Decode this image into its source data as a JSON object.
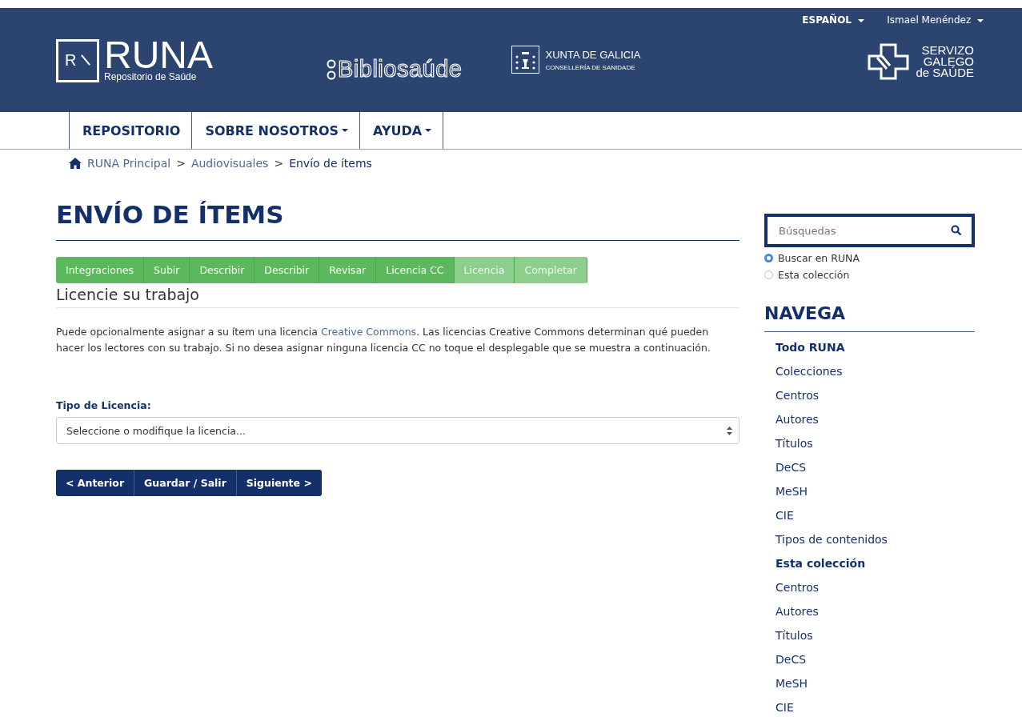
{
  "header": {
    "language": "ESPAÑOL",
    "user": "Ismael Menéndez",
    "logo_title": "RUNA",
    "logo_subtitle": "Repositorio de Saúde",
    "logo_mark": "R",
    "partner": "Bibliosaúde",
    "xunta_title": "XUNTA DE GALICIA",
    "xunta_subtitle": "CONSELLERÍA DE SANIDADE",
    "sergas_lines": [
      "SERVIZO",
      "GALEGO",
      "de SAÚDE"
    ]
  },
  "nav": [
    {
      "label": "REPOSITORIO",
      "dropdown": false
    },
    {
      "label": "SOBRE NOSOTROS",
      "dropdown": true
    },
    {
      "label": "AYUDA",
      "dropdown": true
    }
  ],
  "breadcrumb": [
    {
      "label": "RUNA Principal",
      "link": true
    },
    {
      "label": "Audiovisuales",
      "link": true
    },
    {
      "label": "Envío de ítems",
      "link": false
    }
  ],
  "breadcrumb_separator": ">",
  "page_title": "ENVÍO DE ÍTEMS",
  "steps": [
    {
      "label": "Integraciones",
      "done": true
    },
    {
      "label": "Subir",
      "done": true
    },
    {
      "label": "Describir",
      "done": true
    },
    {
      "label": "Describir",
      "done": true
    },
    {
      "label": "Revisar",
      "done": true
    },
    {
      "label": "Licencia CC",
      "done": true
    },
    {
      "label": "Licencia",
      "done": false
    },
    {
      "label": "Completar",
      "done": false
    }
  ],
  "section_title": "Licencie su trabajo",
  "intro_before": "Puede opcionalmente asignar a su ítem una licencia ",
  "intro_link": "Creative Commons",
  "intro_after": ". Las licencias Creative Commons determinan qué pueden hacer los lectores con su trabajo. Si no desea asignar ninguna licencia CC no toque el desplegable que se muestra a continuación.",
  "license_label": "Tipo de Licencia:",
  "license_select": {
    "value": "Seleccione o modifique la licencia..."
  },
  "buttons": [
    "< Anterior",
    "Guardar / Salir",
    "Siguiente >"
  ],
  "search": {
    "placeholder": "Búsquedas"
  },
  "scope": [
    {
      "label": "Buscar en RUNA",
      "selected": true
    },
    {
      "label": "Esta colección",
      "selected": false
    }
  ],
  "browse_title": "NAVEGA",
  "browse": [
    {
      "heading": "Todo RUNA",
      "items": [
        "Colecciones",
        "Centros",
        "Autores",
        "Títulos",
        "DeCS",
        "MeSH",
        "CIE",
        "Tipos de contenidos"
      ]
    },
    {
      "heading": "Esta colección",
      "items": [
        "Centros",
        "Autores",
        "Títulos",
        "DeCS",
        "MeSH",
        "CIE"
      ]
    }
  ]
}
